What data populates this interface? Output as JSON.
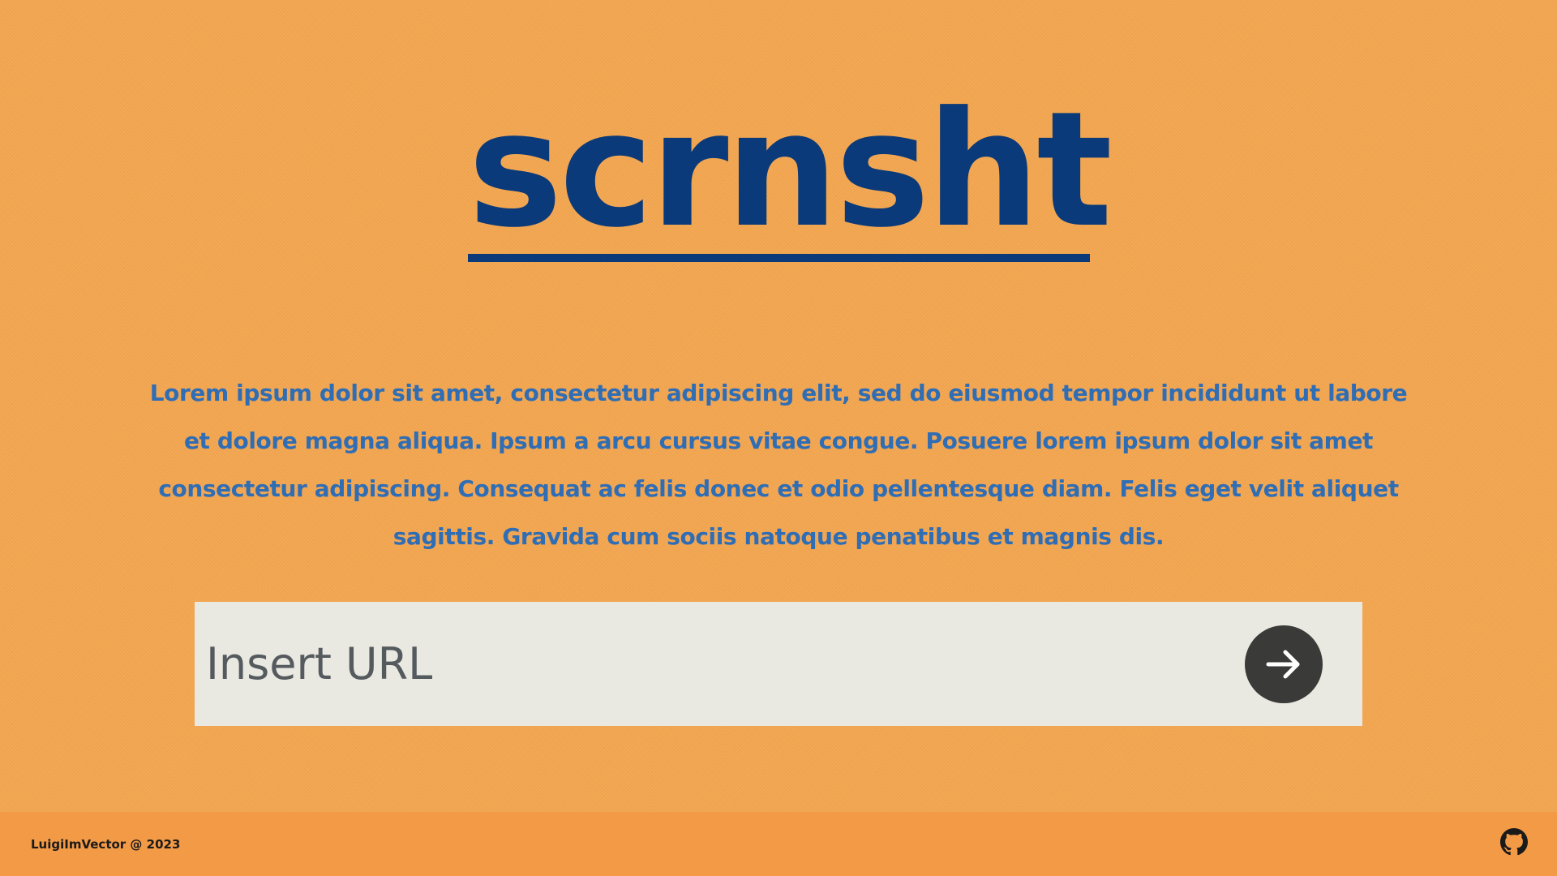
{
  "header": {
    "logo_text": "scrnsht"
  },
  "main": {
    "description": "Lorem ipsum dolor sit amet, consectetur adipiscing elit, sed do eiusmod tempor incididunt ut labore et dolore magna aliqua. Ipsum a arcu cursus vitae congue. Posuere lorem ipsum dolor sit amet consectetur adipiscing. Consequat ac felis donec et odio pellentesque diam. Felis eget velit aliquet sagittis. Gravida cum sociis natoque penatibus et magnis dis.",
    "url_input": {
      "placeholder": "Insert URL",
      "value": ""
    },
    "submit_icon": "arrow-right-icon"
  },
  "footer": {
    "credit": "LuigiImVector @ 2023",
    "github_icon": "github-icon"
  },
  "colors": {
    "background": "#f3a650",
    "footer_background": "#f39a46",
    "logo": "#0a3a7a",
    "description_text": "#2f6db5",
    "input_background": "#e9e8e1",
    "button_background": "#3a3a38"
  }
}
